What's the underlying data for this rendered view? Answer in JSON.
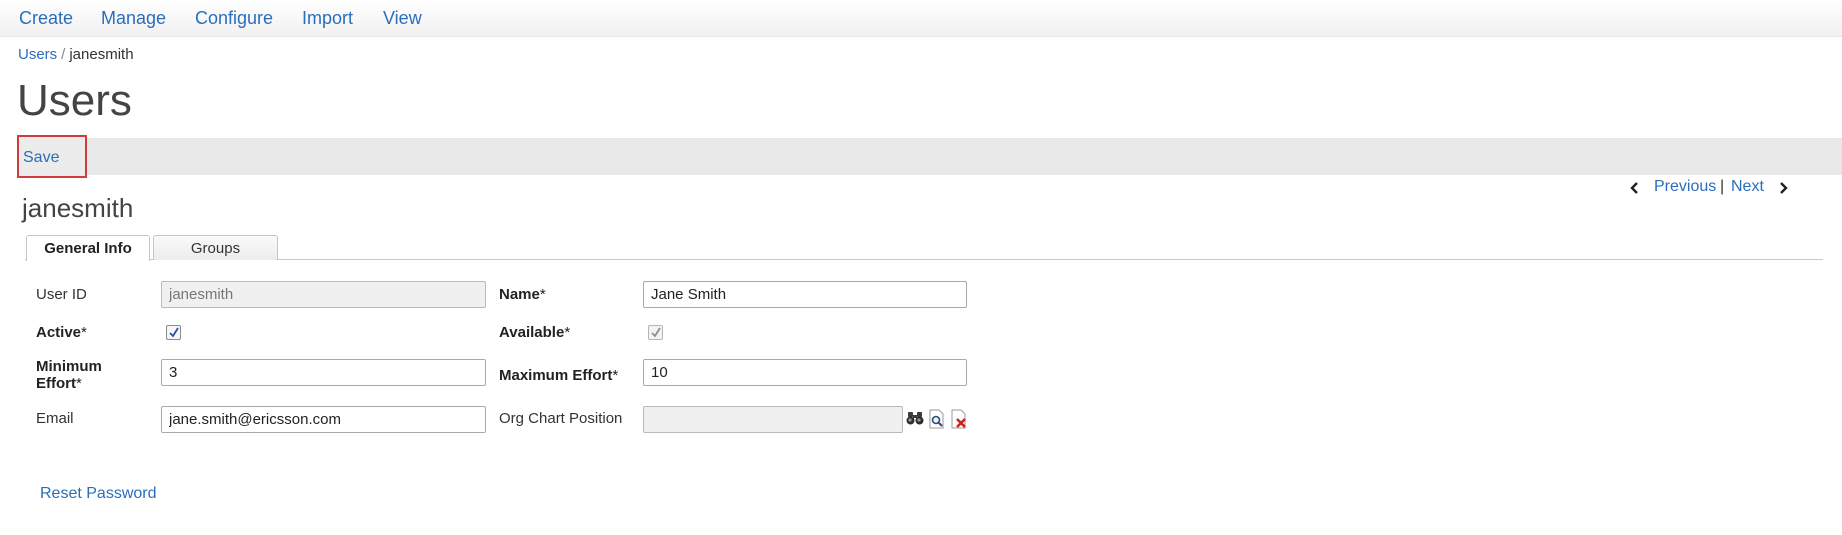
{
  "nav": {
    "items": [
      "Create",
      "Manage",
      "Configure",
      "Import",
      "View"
    ]
  },
  "breadcrumb": {
    "parent": "Users",
    "separator": "/",
    "current": "janesmith"
  },
  "page": {
    "title": "Users"
  },
  "toolbar": {
    "save_label": "Save"
  },
  "pager": {
    "previous_label": "Previous",
    "separator": "|",
    "next_label": "Next"
  },
  "record": {
    "title": "janesmith"
  },
  "tabs": [
    {
      "label": "General Info",
      "active": true
    },
    {
      "label": "Groups",
      "active": false
    }
  ],
  "form": {
    "user_id": {
      "label": "User ID",
      "value": "janesmith"
    },
    "name": {
      "label": "Name",
      "required_mark": "*",
      "value": "Jane Smith"
    },
    "active": {
      "label": "Active",
      "required_mark": "*",
      "checked": true
    },
    "available": {
      "label": "Available",
      "required_mark": "*",
      "checked": true
    },
    "minimum_effort": {
      "label": "Minimum Effort",
      "required_mark": "*",
      "value": "3"
    },
    "maximum_effort": {
      "label": "Maximum Effort",
      "required_mark": "*",
      "value": "10"
    },
    "email": {
      "label": "Email",
      "value": "jane.smith@ericsson.com"
    },
    "org_chart_position": {
      "label": "Org Chart Position",
      "value": ""
    }
  },
  "links": {
    "reset_password": "Reset Password"
  },
  "colors": {
    "link": "#2a6ebb",
    "highlight_border": "#d23b3b",
    "toolbar_bg": "#e8e8e8"
  },
  "icons": {
    "lookup": "binoculars-icon",
    "view": "magnifier-page-icon",
    "clear": "clear-page-icon"
  }
}
